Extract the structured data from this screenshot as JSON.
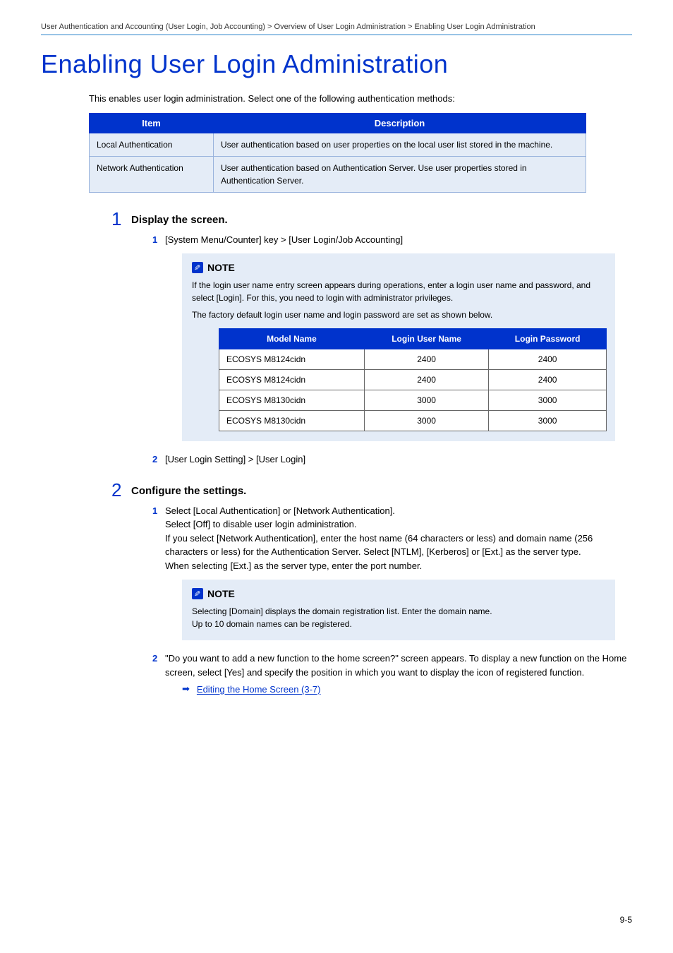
{
  "breadcrumb": "User Authentication and Accounting (User Login, Job Accounting) > Overview of User Login Administration > Enabling User Login Administration",
  "main_title": "Enabling User Login Administration",
  "intro": "This enables user login administration. Select one of the following authentication methods:",
  "table1": {
    "headers": [
      "Item",
      "Description"
    ],
    "rows": [
      {
        "item": "Local Authentication",
        "desc": "User authentication based on user properties on the local user list stored in the machine."
      },
      {
        "item": "Network Authentication",
        "desc": "User authentication based on Authentication Server. Use user properties stored in Authentication Server."
      }
    ]
  },
  "step1": {
    "num": "1",
    "title": "Display the screen.",
    "sub1": {
      "num": "1",
      "text": "[System Menu/Counter] key > [User Login/Job Accounting]"
    },
    "note": {
      "label": "NOTE",
      "body_before": "If the login user name entry screen appears during operations, enter a login user name and password, and select [Login]. For this, you need to login with administrator privileges.",
      "body_after": "The factory default login user name and login password are set as shown below.",
      "table": {
        "headers": [
          "Model Name",
          "Login User Name",
          "Login Password"
        ],
        "rows": [
          {
            "model": "ECOSYS M8124cidn",
            "user": "2400",
            "pass": "2400"
          },
          {
            "model": "ECOSYS M8124cidn",
            "user": "2400",
            "pass": "2400"
          },
          {
            "model": "ECOSYS M8130cidn",
            "user": "3000",
            "pass": "3000"
          },
          {
            "model": "ECOSYS M8130cidn",
            "user": "3000",
            "pass": "3000"
          }
        ]
      }
    },
    "sub2": {
      "num": "2",
      "text": "[User Login Setting] > [User Login]"
    }
  },
  "step2": {
    "num": "2",
    "title": "Configure the settings.",
    "sub1": {
      "num": "1",
      "text_line1": "Select [Local Authentication] or [Network Authentication].",
      "text_line2": "Select [Off] to disable user login administration.",
      "text_line3": "If you select [Network Authentication], enter the host name (64 characters or less) and domain name (256 characters or less) for the Authentication Server. Select [NTLM], [Kerberos] or [Ext.] as the server type.",
      "text_line4": "When selecting [Ext.] as the server type, enter the port number."
    },
    "note": {
      "label": "NOTE",
      "body": "Selecting [Domain] displays the domain registration list. Enter the domain name.\nUp to 10 domain names can be registered."
    },
    "sub2": {
      "num": "2",
      "text_line1": "\"Do you want to add a new function to the home screen?\" screen appears. To display a new function on the Home screen, select [Yes] and specify the position in which you want to display the icon of registered function.",
      "link": "Editing the Home Screen (3-7)"
    }
  },
  "page_num": "9-5"
}
